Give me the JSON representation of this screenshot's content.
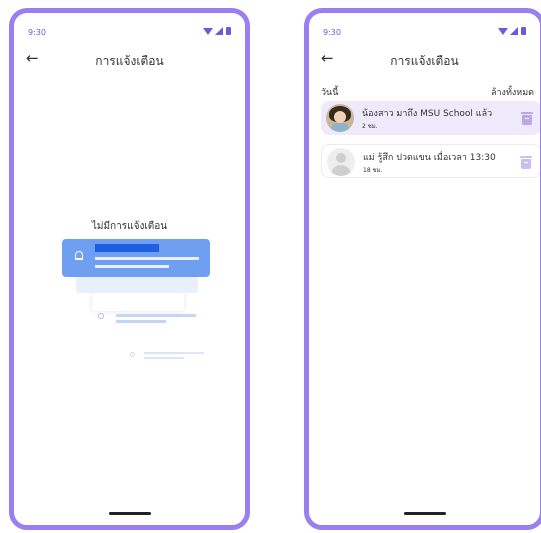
{
  "colors": {
    "frame": "#9a7ff0",
    "accent": "#6c5bd6",
    "illustration_blue": "#6f9ff1",
    "unread_background": "#efe9fc",
    "trash_icon": "#b8a8ea"
  },
  "left_screen": {
    "status_time": "9:30",
    "status_icons": [
      "wifi-icon",
      "signal-icon",
      "battery-icon"
    ],
    "back_icon": "←",
    "title": "การแจ้งเตือน",
    "empty_message": "ไม่มีการแจ้งเตือน",
    "illustration_icon": "bell-icon"
  },
  "right_screen": {
    "status_time": "9:30",
    "status_icons": [
      "wifi-icon",
      "signal-icon",
      "battery-icon"
    ],
    "back_icon": "←",
    "title": "การแจ้งเตือน",
    "section_label": "วันนี้",
    "clear_all_label": "ล้างทั้งหมด",
    "notifications": [
      {
        "message": "น้องสาว มาถึง MSU School แล้ว",
        "time": "2 ชม.",
        "avatar": "photo-avatar",
        "unread": true
      },
      {
        "message": "แม่ รู้สึก ปวดแขน เมื่อเวลา 13:30",
        "time": "18 ชม.",
        "avatar": "default-avatar",
        "unread": false
      }
    ]
  }
}
